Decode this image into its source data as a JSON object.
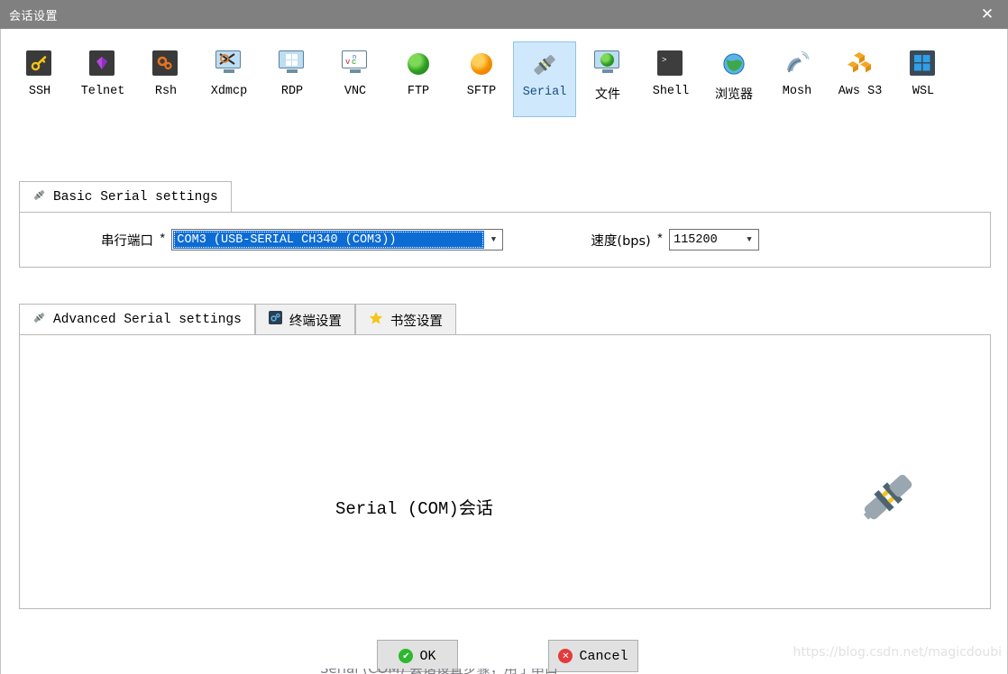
{
  "window": {
    "title": "会话设置",
    "close_label": "✕"
  },
  "toolbar": {
    "items": [
      {
        "label": "SSH",
        "icon": "key-icon"
      },
      {
        "label": "Telnet",
        "icon": "gem-icon"
      },
      {
        "label": "Rsh",
        "icon": "gears-icon"
      },
      {
        "label": "Xdmcp",
        "icon": "monitor-x-icon"
      },
      {
        "label": "RDP",
        "icon": "monitor-windows-icon"
      },
      {
        "label": "VNC",
        "icon": "monitor-vnc-icon"
      },
      {
        "label": "FTP",
        "icon": "globe-green-icon"
      },
      {
        "label": "SFTP",
        "icon": "globe-orange-icon"
      },
      {
        "label": "Serial",
        "icon": "plug-icon",
        "selected": true
      },
      {
        "label": "文件",
        "icon": "monitor-globe-icon"
      },
      {
        "label": "Shell",
        "icon": "terminal-icon"
      },
      {
        "label": "浏览器",
        "icon": "globe-browser-icon"
      },
      {
        "label": "Mosh",
        "icon": "satellite-icon"
      },
      {
        "label": "Aws S3",
        "icon": "aws-cubes-icon"
      },
      {
        "label": "WSL",
        "icon": "windows-icon"
      }
    ]
  },
  "basic_group": {
    "tab_label": "Basic Serial settings",
    "tab_icon": "plug-icon",
    "port_label": "串行端口",
    "port_required": "*",
    "port_value": "COM3  (USB-SERIAL CH340 (COM3))",
    "speed_label": "速度(bps)",
    "speed_required": "*",
    "speed_value": "115200"
  },
  "advanced_group": {
    "tabs": [
      {
        "label": "Advanced Serial settings",
        "icon": "plug-icon",
        "active": true
      },
      {
        "label": "终端设置",
        "icon": "terminal-settings-icon",
        "active": false
      },
      {
        "label": "书签设置",
        "icon": "star-icon",
        "active": false
      }
    ],
    "content_text": "Serial (COM)会话",
    "content_icon": "plug-large-icon"
  },
  "buttons": {
    "ok": "OK",
    "cancel": "Cancel"
  },
  "watermark": "https://blog.csdn.net/magicdoubi",
  "bottom_cut_text": "Serial (COM) 会话设置步骤，用于串口"
}
